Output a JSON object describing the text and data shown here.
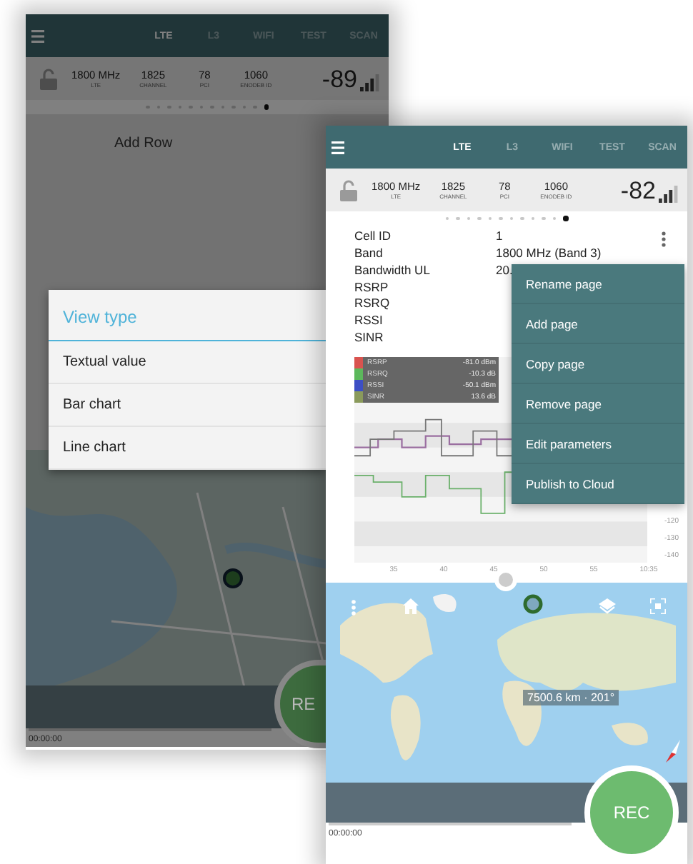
{
  "phones": [
    {
      "kind": "dialog",
      "tabs": [
        {
          "label": "LTE",
          "selected": true
        },
        {
          "label": "L3",
          "selected": false
        },
        {
          "label": "WIFI",
          "selected": false
        },
        {
          "label": "TEST",
          "selected": false
        },
        {
          "label": "SCAN",
          "selected": false
        }
      ],
      "info": [
        {
          "value": "1800 MHz",
          "label": "LTE"
        },
        {
          "value": "1825",
          "label": "CHANNEL"
        },
        {
          "value": "78",
          "label": "PCI"
        },
        {
          "value": "1060",
          "label": "ENODEB ID"
        }
      ],
      "signal": "-89",
      "pages": [
        {
          "selected": false
        },
        {
          "selected": false
        },
        {
          "selected": false
        },
        {
          "selected": false
        },
        {
          "selected": false
        },
        {
          "selected": false
        },
        {
          "selected": false
        },
        {
          "selected": false
        },
        {
          "selected": false
        },
        {
          "selected": false
        },
        {
          "selected": false
        },
        {
          "selected": true
        }
      ],
      "add_row": "Add Row",
      "dialog": {
        "title": "View type",
        "options": [
          "Textual value",
          "Bar chart",
          "Line chart"
        ]
      },
      "rec_button": "RE",
      "timer": "00:00:00"
    },
    {
      "kind": "menu",
      "tabs": [
        {
          "label": "LTE",
          "selected": true
        },
        {
          "label": "L3",
          "selected": false
        },
        {
          "label": "WIFI",
          "selected": false
        },
        {
          "label": "TEST",
          "selected": false
        },
        {
          "label": "SCAN",
          "selected": false
        }
      ],
      "info": [
        {
          "value": "1800 MHz",
          "label": "LTE"
        },
        {
          "value": "1825",
          "label": "CHANNEL"
        },
        {
          "value": "78",
          "label": "PCI"
        },
        {
          "value": "1060",
          "label": "ENODEB ID"
        }
      ],
      "signal": "-82",
      "pages": [
        {
          "selected": false
        },
        {
          "selected": false
        },
        {
          "selected": false
        },
        {
          "selected": false
        },
        {
          "selected": false
        },
        {
          "selected": false
        },
        {
          "selected": false
        },
        {
          "selected": false
        },
        {
          "selected": false
        },
        {
          "selected": false
        },
        {
          "selected": false
        },
        {
          "selected": true
        }
      ],
      "rows": [
        {
          "label": "Cell ID",
          "value": "1"
        },
        {
          "label": "Band",
          "value": "1800 MHz (Band 3)"
        },
        {
          "label": "Bandwidth UL",
          "value": "20."
        },
        {
          "label": "RSRP"
        },
        {
          "label": "RSRQ"
        },
        {
          "label": "RSSI"
        },
        {
          "label": "SINR"
        }
      ],
      "legend": [
        {
          "name": "RSRP",
          "reading": "-81.0 dBm",
          "color": "#d9534f"
        },
        {
          "name": "RSRQ",
          "reading": "-10.3 dB",
          "color": "#5cb85c"
        },
        {
          "name": "RSSI",
          "reading": "-50.1 dBm",
          "color": "#3d4fc4"
        },
        {
          "name": "SINR",
          "reading": "13.6 dB",
          "color": "#8a9a5b"
        }
      ],
      "chart": {
        "y_ticks": [
          "-120",
          "-130",
          "-140"
        ],
        "x_ticks": [
          "35",
          "40",
          "45",
          "50",
          "55",
          "10:35"
        ]
      },
      "menu": {
        "items": [
          "Rename page",
          "Add page",
          "Copy page",
          "Remove page",
          "Edit parameters",
          "Publish to Cloud"
        ]
      },
      "map": {
        "distance": "7500.6 km · 201°"
      },
      "rec_button": "REC",
      "timer": "00:00:00"
    }
  ]
}
